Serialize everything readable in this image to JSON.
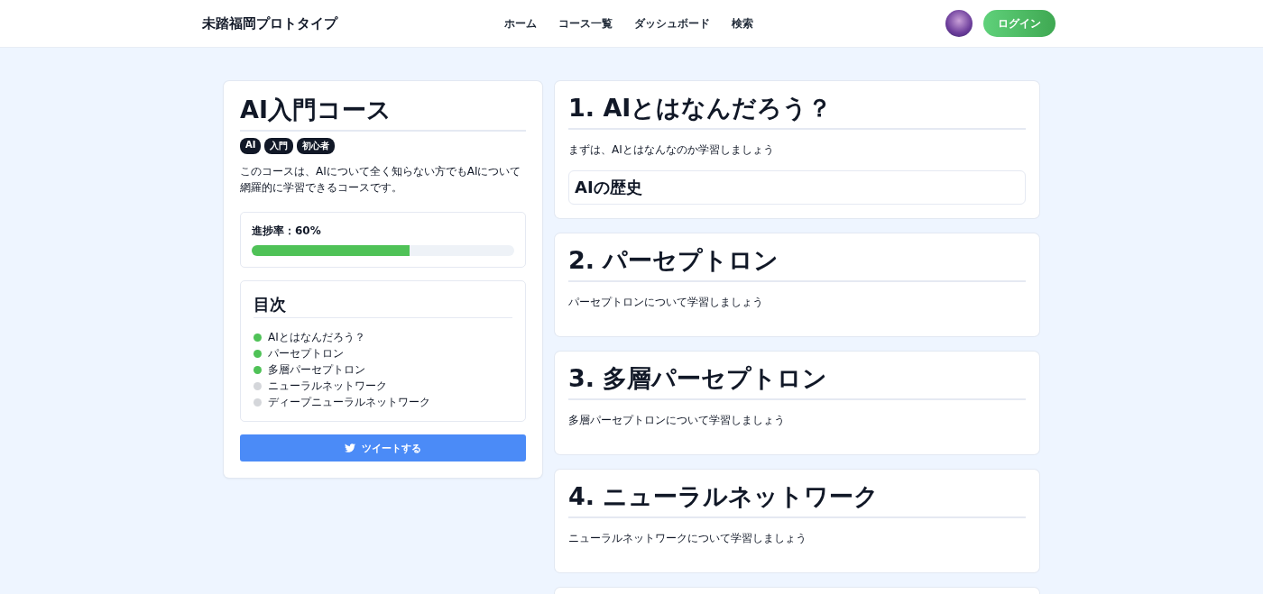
{
  "header": {
    "site_title": "未踏福岡プロトタイプ",
    "nav": [
      {
        "label": "ホーム"
      },
      {
        "label": "コース一覧"
      },
      {
        "label": "ダッシュボード"
      },
      {
        "label": "検索"
      }
    ],
    "login_button": "ログイン"
  },
  "course": {
    "title": "AI入門コース",
    "tags": [
      "AI",
      "入門",
      "初心者"
    ],
    "description": "このコースは、AIについて全く知らない方でもAIについて網羅的に学習できるコースです。",
    "progress": {
      "label": "進捗率：60%",
      "level": 0.6
    },
    "toc": {
      "title": "目次",
      "items": [
        {
          "label": "AIとはなんだろう？",
          "done": true
        },
        {
          "label": "パーセプトロン",
          "done": true
        },
        {
          "label": "多層パーセプトロン",
          "done": true
        },
        {
          "label": "ニューラルネットワーク",
          "done": false
        },
        {
          "label": "ディープニューラルネットワーク",
          "done": false
        }
      ]
    },
    "tweet_button": "ツイートする"
  },
  "sections": [
    {
      "kind": "lesson",
      "title": "1. AIとはなんだろう？",
      "body": "まずは、AIとはなんなのか学習しましょう",
      "subsections": [
        "AIの歴史"
      ]
    },
    {
      "kind": "lesson",
      "title": "2. パーセプトロン",
      "body": "パーセプトロンについて学習しましょう"
    },
    {
      "kind": "lesson",
      "title": "3. 多層パーセプトロン",
      "body": "多層パーセプトロンについて学習しましょう"
    },
    {
      "kind": "lesson",
      "title": "4. ニューラルネットワーク",
      "body": "ニューラルネットワークについて学習しましょう"
    },
    {
      "kind": "cut"
    }
  ]
}
